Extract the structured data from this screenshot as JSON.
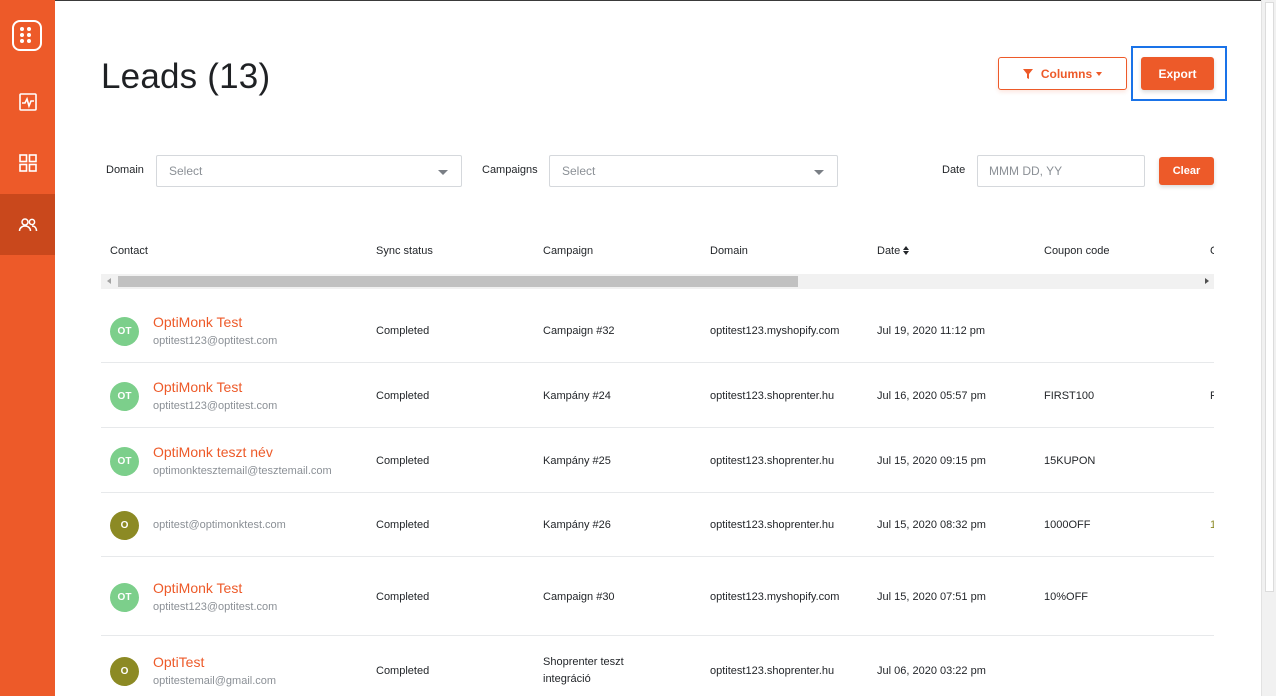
{
  "sidebar": {
    "items": [
      {
        "icon": "activity-icon"
      },
      {
        "icon": "grid-icon"
      },
      {
        "icon": "users-icon",
        "active": true
      }
    ]
  },
  "header": {
    "title": "Leads (13)",
    "columns_label": "Columns",
    "export_label": "Export"
  },
  "filters": {
    "domain_label": "Domain",
    "domain_placeholder": "Select",
    "campaigns_label": "Campaigns",
    "campaigns_placeholder": "Select",
    "date_label": "Date",
    "date_placeholder": "MMM DD, YY",
    "clear_label": "Clear"
  },
  "table": {
    "columns": [
      "Contact",
      "Sync status",
      "Campaign",
      "Domain",
      "Date",
      "Coupon code",
      "C"
    ],
    "rows": [
      {
        "initials": "OT",
        "avatar_color": "#7ccf8b",
        "name": "OptiMonk Test",
        "email": "optitest123@optitest.com",
        "sync": "Completed",
        "campaign": "Campaign #32",
        "campaign2": "",
        "domain": "optitest123.myshopify.com",
        "date": "Jul 19, 2020 11:12 pm",
        "coupon": "",
        "extra": ""
      },
      {
        "initials": "OT",
        "avatar_color": "#7ccf8b",
        "name": "OptiMonk Test",
        "email": "optitest123@optitest.com",
        "sync": "Completed",
        "campaign": "Kampány #24",
        "campaign2": "",
        "domain": "optitest123.shoprenter.hu",
        "date": "Jul 16, 2020 05:57 pm",
        "coupon": "FIRST100",
        "extra": "F"
      },
      {
        "initials": "OT",
        "avatar_color": "#7ccf8b",
        "name": "OptiMonk teszt név",
        "email": "optimonktesztemail@tesztemail.com",
        "sync": "Completed",
        "campaign": "Kampány #25",
        "campaign2": "",
        "domain": "optitest123.shoprenter.hu",
        "date": "Jul 15, 2020 09:15 pm",
        "coupon": "15KUPON",
        "extra": ""
      },
      {
        "initials": "O",
        "avatar_color": "#8c8a24",
        "name": "",
        "email": "optitest@optimonktest.com",
        "sync": "Completed",
        "campaign": "Kampány #26",
        "campaign2": "",
        "domain": "optitest123.shoprenter.hu",
        "date": "Jul 15, 2020 08:32 pm",
        "coupon": "1000OFF",
        "extra": "1"
      },
      {
        "initials": "OT",
        "avatar_color": "#7ccf8b",
        "name": "OptiMonk Test",
        "email": "optitest123@optitest.com",
        "sync": "Completed",
        "campaign": "Campaign #30",
        "campaign2": "",
        "domain": "optitest123.myshopify.com",
        "date": "Jul 15, 2020 07:51 pm",
        "coupon": "10%OFF",
        "extra": ""
      },
      {
        "initials": "O",
        "avatar_color": "#8c8a24",
        "name": "OptiTest",
        "email": "optitestemail@gmail.com",
        "sync": "Completed",
        "campaign": "Shoprenter teszt",
        "campaign2": "integráció",
        "domain": "optitest123.shoprenter.hu",
        "date": "Jul 06, 2020 03:22 pm",
        "coupon": "",
        "extra": ""
      }
    ]
  },
  "colors": {
    "accent": "#ed5a29",
    "sidebar_active": "#c9481c",
    "highlight": "#1a73e8"
  }
}
